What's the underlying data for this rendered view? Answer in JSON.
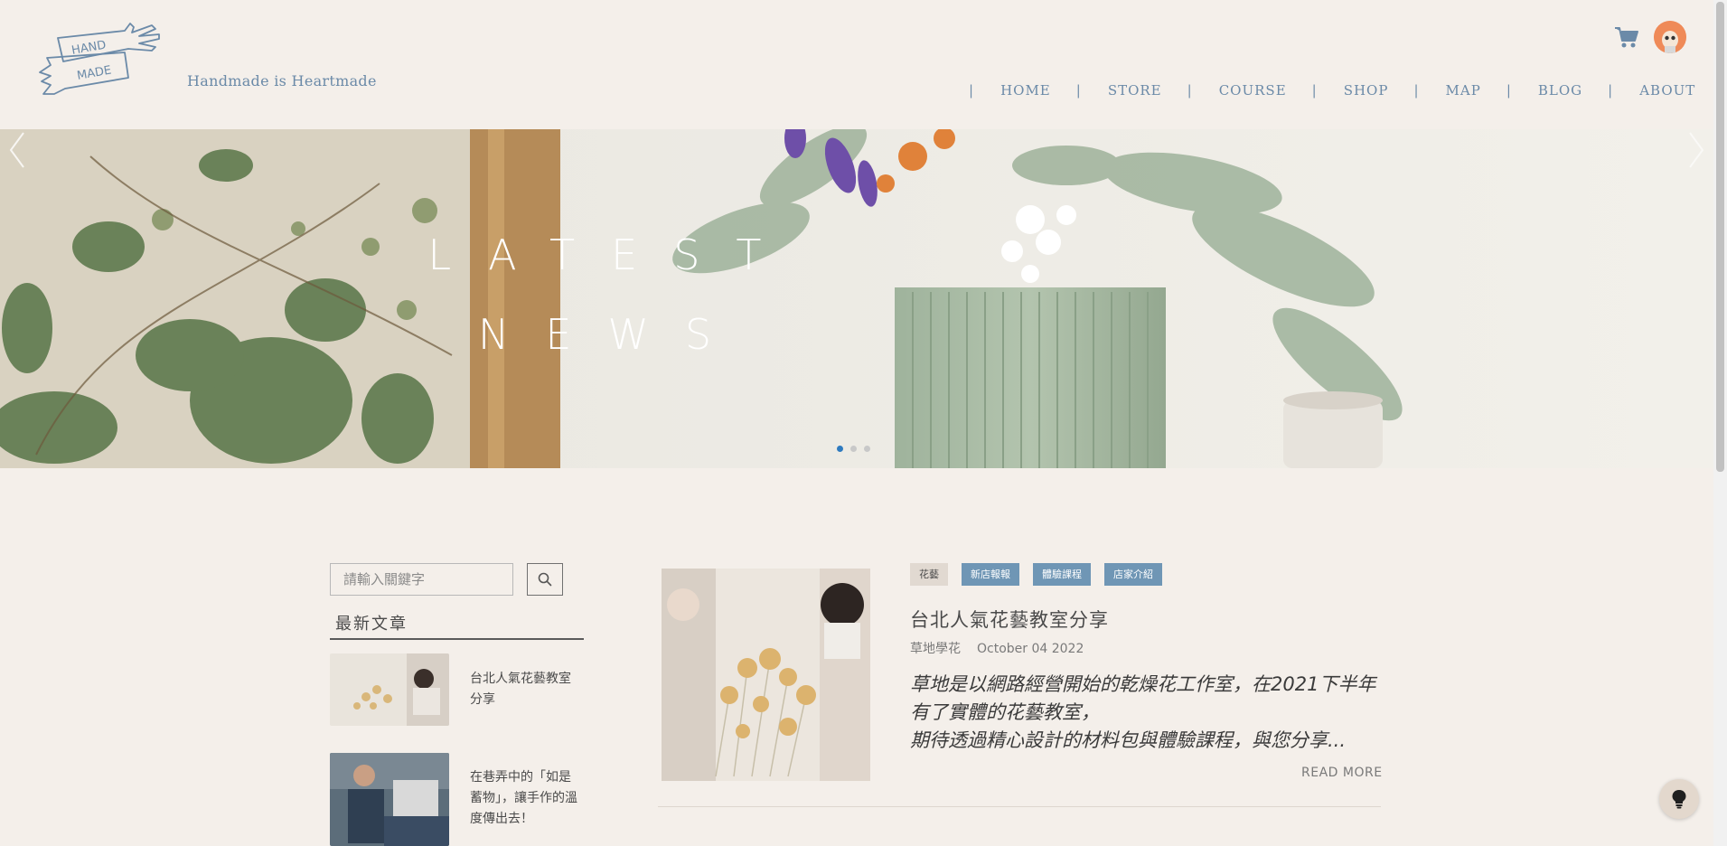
{
  "header": {
    "tagline": "Handmade is Heartmade",
    "nav": [
      {
        "label": "HOME",
        "name": "nav-home"
      },
      {
        "label": "STORE",
        "name": "nav-store"
      },
      {
        "label": "COURSE",
        "name": "nav-course"
      },
      {
        "label": "SHOP",
        "name": "nav-shop"
      },
      {
        "label": "MAP",
        "name": "nav-map"
      },
      {
        "label": "BLOG",
        "name": "nav-blog"
      },
      {
        "label": "ABOUT",
        "name": "nav-about"
      }
    ],
    "nav_separator": "|"
  },
  "hero": {
    "title_line1": "LATEST",
    "title_line2": "NEWS",
    "slides_total": 3,
    "active_slide": 1
  },
  "sidebar": {
    "search_placeholder": "請輸入關鍵字",
    "recent_title": "最新文章",
    "recent_posts": [
      {
        "title": "台北人氣花藝教室分享"
      },
      {
        "title": "在巷弄中的「如是蓄物」，讓手作的溫度傳出去！"
      }
    ]
  },
  "post": {
    "tags": [
      "花藝",
      "新店報報",
      "體驗課程",
      "店家介紹"
    ],
    "title": "台北人氣花藝教室分享",
    "author": "草地學花",
    "date": "October 04 2022",
    "excerpt_line1": "草地是以網路經營開始的乾燥花工作室，在2021下半年有了實體的花藝教室，",
    "excerpt_line2": "期待透過精心設計的材料包與體驗課程，與您分享...",
    "read_more": "READ MORE"
  },
  "colors": {
    "background": "#f4efea",
    "accent_blue": "#6b8aa8",
    "tag_blue": "#6f96b5",
    "dot_active": "#2f7bbf"
  },
  "icons": {
    "cart": "cart-icon",
    "search": "search-icon",
    "prev": "chevron-left-icon",
    "next": "chevron-right-icon",
    "help": "lightbulb-icon"
  }
}
